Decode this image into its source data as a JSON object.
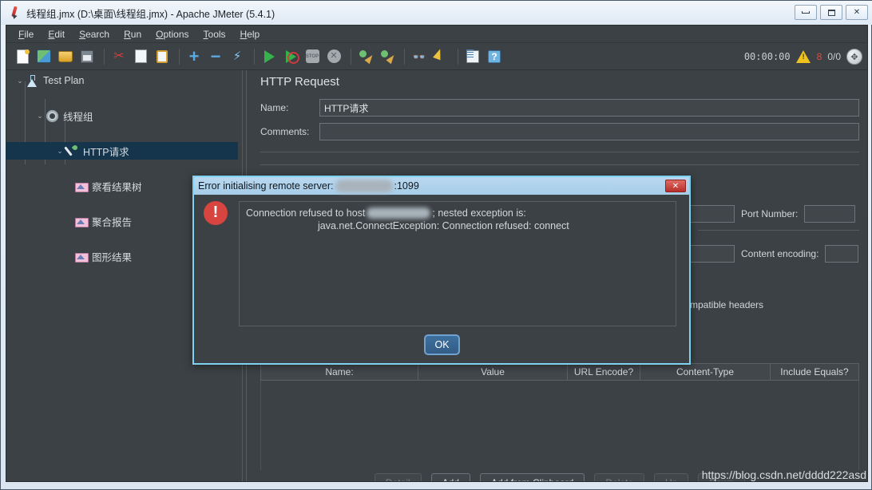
{
  "window": {
    "title": "线程组.jmx (D:\\桌面\\线程组.jmx) - Apache JMeter (5.4.1)",
    "minimize_label": "Minimize",
    "maximize_label": "Maximize",
    "close_label": "✕"
  },
  "menubar": [
    {
      "label": "File",
      "mnemonic": "F"
    },
    {
      "label": "Edit",
      "mnemonic": "E"
    },
    {
      "label": "Search",
      "mnemonic": "S"
    },
    {
      "label": "Run",
      "mnemonic": "R"
    },
    {
      "label": "Options",
      "mnemonic": "O"
    },
    {
      "label": "Tools",
      "mnemonic": "T"
    },
    {
      "label": "Help",
      "mnemonic": "H"
    }
  ],
  "toolbar": {
    "icons": [
      "new-document-icon",
      "templates-icon",
      "open-icon",
      "save-icon",
      "cut-icon",
      "copy-icon",
      "paste-icon",
      "expand-all-icon",
      "collapse-all-icon",
      "toggle-icon",
      "start-icon",
      "start-no-pauses-icon",
      "stop-icon",
      "shutdown-icon",
      "clear-icon",
      "clear-all-icon",
      "search-icon",
      "reset-search-icon",
      "function-helper-icon",
      "help-icon"
    ],
    "timer": "00:00:00",
    "warning_icon": "warning-triangle-icon",
    "warning_count": "8",
    "threads": "0/0",
    "status_icon": "remote-status-icon"
  },
  "tree": {
    "nodes": [
      {
        "label": "Test Plan",
        "icon": "test-plan-icon",
        "depth": 0,
        "twisty": "⌄",
        "selected": false
      },
      {
        "label": "线程组",
        "icon": "thread-group-icon",
        "depth": 1,
        "twisty": "⌄",
        "selected": false
      },
      {
        "label": "HTTP请求",
        "icon": "http-request-icon",
        "depth": 2,
        "twisty": "⌄",
        "selected": true
      },
      {
        "label": "察看结果树",
        "icon": "listener-icon",
        "depth": 3,
        "twisty": "",
        "selected": false
      },
      {
        "label": "聚合报告",
        "icon": "listener-icon",
        "depth": 3,
        "twisty": "",
        "selected": false
      },
      {
        "label": "图形结果",
        "icon": "listener-icon",
        "depth": 3,
        "twisty": "",
        "selected": false
      }
    ]
  },
  "http_request": {
    "panel_title": "HTTP Request",
    "name_label": "Name:",
    "name_value": "HTTP请求",
    "comments_label": "Comments:",
    "comments_value": "",
    "port_label": "Port Number:",
    "port_value": "",
    "content_encoding_label": "Content encoding:",
    "content_encoding_value": "",
    "browser_headers_label": "mpatible headers",
    "table": {
      "columns": [
        "Name:",
        "Value",
        "URL Encode?",
        "Content-Type",
        "Include Equals?"
      ],
      "rows": []
    },
    "buttons": [
      {
        "label": "Detail",
        "disabled": true
      },
      {
        "label": "Add",
        "disabled": false
      },
      {
        "label": "Add from Clipboard",
        "disabled": false
      },
      {
        "label": "Delete",
        "disabled": true
      },
      {
        "label": "Up",
        "disabled": true
      },
      {
        "label": "Down",
        "disabled": true
      }
    ]
  },
  "dialog": {
    "title_prefix": "Error initialising remote server:",
    "title_suffix": ":1099",
    "host_redacted": "",
    "error_icon": "error-circle-icon",
    "message_line1_prefix": "Connection refused to host",
    "message_line1_suffix": "; nested exception is:",
    "message_line2": "java.net.ConnectException: Connection refused: connect",
    "ok_label": "OK",
    "close_label": "✕"
  },
  "watermark": "https://blog.csdn.net/dddd222asd"
}
